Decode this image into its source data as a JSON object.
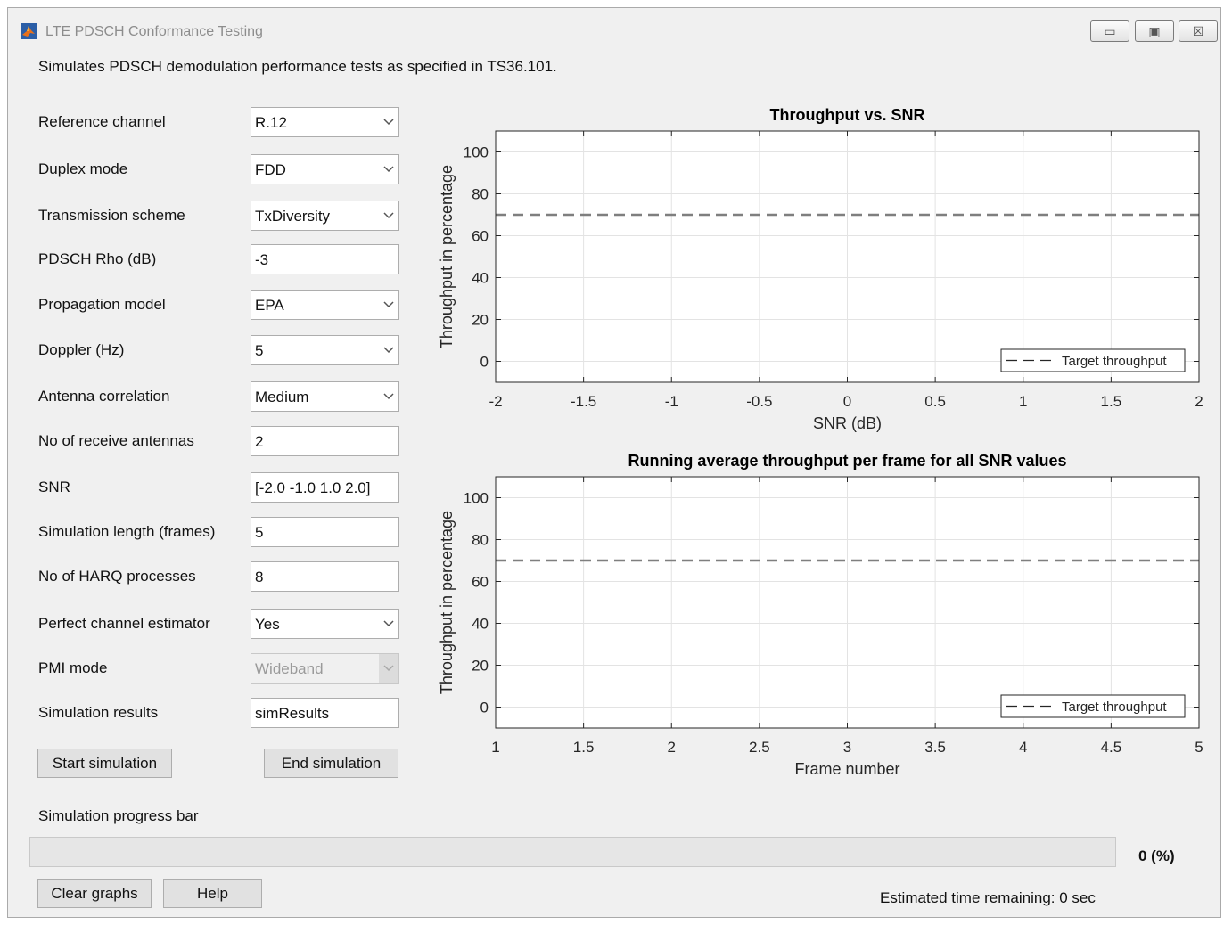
{
  "window": {
    "title": "LTE PDSCH Conformance Testing",
    "minimize_glyph": "▭",
    "maximize_glyph": "▣",
    "close_glyph": "☒"
  },
  "description": "Simulates PDSCH demodulation performance tests as specified in TS36.101.",
  "form": [
    {
      "label": "Reference channel",
      "value": "R.12",
      "type": "dropdown"
    },
    {
      "label": "Duplex mode",
      "value": "FDD",
      "type": "dropdown"
    },
    {
      "label": "Transmission scheme",
      "value": "TxDiversity",
      "type": "dropdown"
    },
    {
      "label": "PDSCH Rho (dB)",
      "value": "-3",
      "type": "text"
    },
    {
      "label": "Propagation model",
      "value": "EPA",
      "type": "dropdown"
    },
    {
      "label": "Doppler (Hz)",
      "value": "5",
      "type": "dropdown"
    },
    {
      "label": "Antenna correlation",
      "value": "Medium",
      "type": "dropdown"
    },
    {
      "label": "No of receive antennas",
      "value": "2",
      "type": "text"
    },
    {
      "label": "SNR",
      "value": "[-2.0 -1.0 1.0 2.0]",
      "type": "text"
    },
    {
      "label": "Simulation length (frames)",
      "value": "5",
      "type": "text"
    },
    {
      "label": "No of HARQ processes",
      "value": "8",
      "type": "text"
    },
    {
      "label": "Perfect channel estimator",
      "value": "Yes",
      "type": "dropdown"
    },
    {
      "label": "PMI mode",
      "value": "Wideband",
      "type": "dropdown",
      "disabled": true
    },
    {
      "label": "Simulation results",
      "value": "simResults",
      "type": "text"
    }
  ],
  "buttons": {
    "start": "Start simulation",
    "end": "End simulation",
    "clear": "Clear graphs",
    "help": "Help"
  },
  "progress": {
    "label": "Simulation progress bar",
    "value": 0,
    "text": "0 (%)",
    "fill_color": "#4c9a4c"
  },
  "eta": "Estimated time remaining:  0 sec",
  "chart_data": [
    {
      "type": "line",
      "title": "Throughput vs. SNR",
      "xlabel": "SNR (dB)",
      "ylabel": "Throughput in percentage",
      "xlim": [
        -2,
        2
      ],
      "ylim": [
        -10,
        110
      ],
      "x_ticks": [
        "-2",
        "-1.5",
        "-1",
        "-0.5",
        "0",
        "0.5",
        "1",
        "1.5",
        "2"
      ],
      "y_ticks": [
        "0",
        "20",
        "40",
        "60",
        "80",
        "100"
      ],
      "grid": true,
      "legend_position": "bottom-right",
      "series": [
        {
          "name": "Target throughput",
          "style": "dashed",
          "color": "#7f7f7f",
          "x": [
            -2,
            2
          ],
          "y": [
            70,
            70
          ]
        }
      ]
    },
    {
      "type": "line",
      "title": "Running average throughput per frame for all SNR values",
      "xlabel": "Frame number",
      "ylabel": "Throughput in percentage",
      "xlim": [
        1,
        5
      ],
      "ylim": [
        -10,
        110
      ],
      "x_ticks": [
        "1",
        "1.5",
        "2",
        "2.5",
        "3",
        "3.5",
        "4",
        "4.5",
        "5"
      ],
      "y_ticks": [
        "0",
        "20",
        "40",
        "60",
        "80",
        "100"
      ],
      "grid": true,
      "legend_position": "bottom-right",
      "series": [
        {
          "name": "Target throughput",
          "style": "dashed",
          "color": "#7f7f7f",
          "x": [
            1,
            5
          ],
          "y": [
            70,
            70
          ]
        }
      ]
    }
  ]
}
